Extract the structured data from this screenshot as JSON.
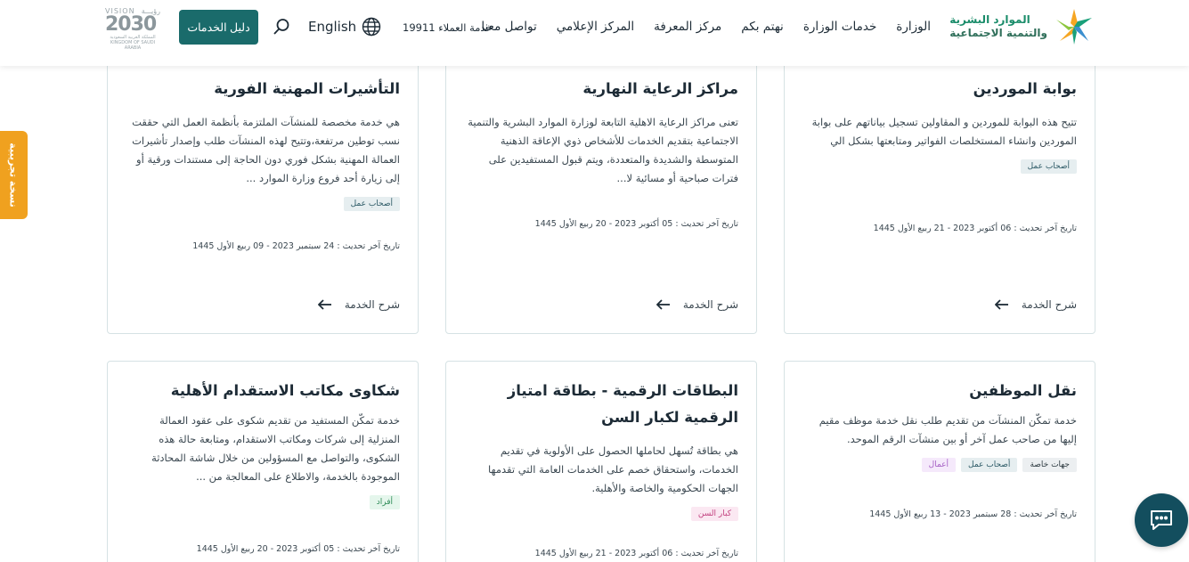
{
  "header": {
    "logo_line1": "الموارد البشرية",
    "logo_line2": "والتنمية الاجتماعية",
    "nav": [
      "الوزارة",
      "خدمات الوزارة",
      "نهتم بكم",
      "مركز المعرفة",
      "المركز الإعلامي",
      "تواصل معنا"
    ],
    "customer_service": "خدمة العملاء 19911",
    "language": "English",
    "guide_button": "دليل الخدمات",
    "vision_ar": "رؤيـــة",
    "vision_en": "VISION",
    "vision_year": "2030",
    "vision_sub_ar": "المملكة العربية السعودية",
    "vision_sub_en": "KINGDOM OF SAUDI ARABIA"
  },
  "beta_tab": "نسخة تجريبية",
  "explain_label": "شرح الخدمة",
  "cards": [
    {
      "title": "بوابة الموردين",
      "desc": "تتيح هذه البوابة للموردين و المقاولين تسجيل بياناتهم على بوابة الموردين وانشاء المستخلصات الفواتير ومتابعتها بشكل الي",
      "tags": [
        "أصحاب عمل"
      ],
      "updated": "تاريخ آخر تحديث : 06 أكتوبر 2023 - 21 ربيع الأول 1445"
    },
    {
      "title": "مراكز الرعاية النهارية",
      "desc": "تعنى مراكز الرعاية الاهلية التابعة لوزارة الموارد البشرية والتنمية الاجتماعية بتقديم الخدمات للأشخاص ذوي الإعاقة الذهنية المتوسطة والشديدة والمتعددة، ويتم قبول المستفيدين على فترات صباحية أو مسائية لا...",
      "tags": [],
      "updated": "تاريخ آخر تحديث : 05 أكتوبر 2023 - 20 ربيع الأول 1445"
    },
    {
      "title": "التأشيرات المهنية الفورية",
      "desc": "هي خدمة مخصصة للمنشآت الملتزمة بأنظمة العمل التي حققت نسب توطين مرتفعة،وتتيح لهذه المنشآت طلب وإصدار تأشيرات العمالة المهنية بشكل فوري دون الحاجة إلى مستندات ورقية أو إلى زيارة أحد فروع وزارة الموارد ...",
      "tags": [
        "أصحاب عمل"
      ],
      "updated": "تاريخ آخر تحديث : 24 سبتمبر 2023 - 09 ربيع الأول 1445"
    },
    {
      "title": "نقل الموظفين",
      "desc": "خدمة تمكّن المنشآت من تقديم طلب نقل خدمة موظف مقيم إليها من صاحب عمل آخر أو بين منشآت الرقم الموحد.",
      "tags": [
        "جهات خاصة",
        "أصحاب عمل",
        "أعمال"
      ],
      "updated": "تاريخ آخر تحديث : 28 سبتمبر 2023 - 13 ربيع الأول 1445"
    },
    {
      "title": "البطاقات الرقمية - بطاقة امتياز الرقمية لكبار السن",
      "desc": "هي بطاقة تُسهل لحاملها الحصول على الأولوية في تقديم الخدمات، واستحقاق خصم على الخدمات العامة التي تقدمها الجهات الحكومية والخاصة والأهلية.",
      "tags": [
        "كبار السن"
      ],
      "updated": "تاريخ آخر تحديث : 06 أكتوبر 2023 - 21 ربيع الأول 1445"
    },
    {
      "title": "شكاوى مكاتب الاستقدام الأهلية",
      "desc": "خدمة تمكّن المستفيد من تقديم شكوى على عقود العمالة المنزلية إلى شركات ومكاتب الاستقدام، ومتابعة حالة هذه الشكوى، والتواصل مع المسؤولين من خلال شاشة المحادثة الموجودة بالخدمة، والاطلاع على المعالجة من ...",
      "tags": [
        "أفراد"
      ],
      "updated": "تاريخ آخر تحديث : 05 أكتوبر 2023 - 20 ربيع الأول 1445"
    }
  ]
}
